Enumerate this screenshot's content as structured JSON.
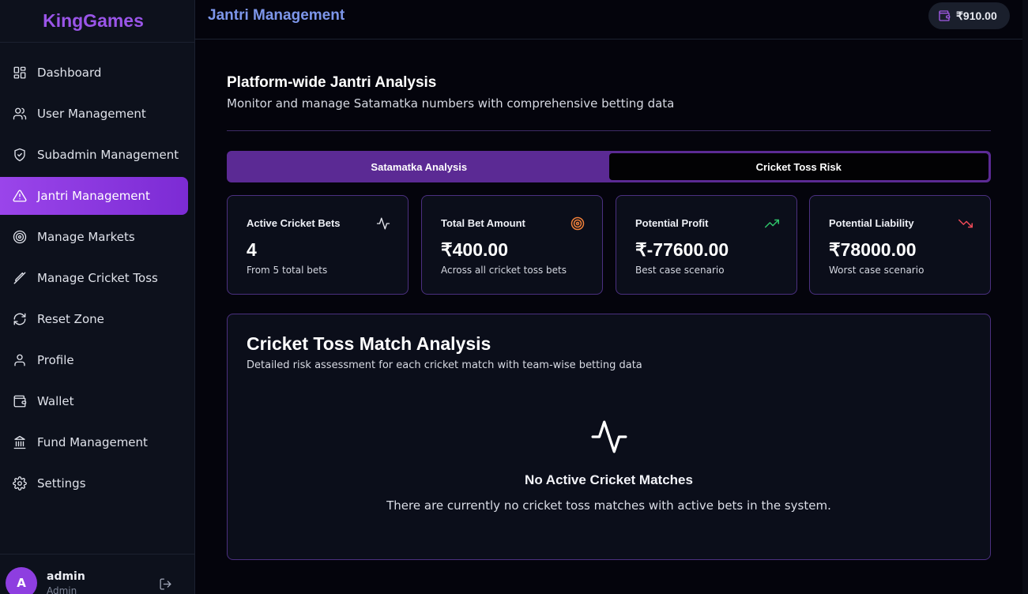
{
  "brand": "KingGames",
  "header": {
    "title": "Jantri Management",
    "wallet_balance": "₹910.00"
  },
  "sidebar": {
    "items": [
      {
        "label": "Dashboard",
        "icon": "dashboard-icon"
      },
      {
        "label": "User Management",
        "icon": "users-icon"
      },
      {
        "label": "Subadmin Management",
        "icon": "shield-icon"
      },
      {
        "label": "Jantri Management",
        "icon": "warning-icon",
        "active": true
      },
      {
        "label": "Manage Markets",
        "icon": "target-icon"
      },
      {
        "label": "Manage Cricket Toss",
        "icon": "cricket-bat-icon"
      },
      {
        "label": "Reset Zone",
        "icon": "refresh-icon"
      },
      {
        "label": "Profile",
        "icon": "user-icon"
      },
      {
        "label": "Wallet",
        "icon": "wallet-icon"
      },
      {
        "label": "Fund Management",
        "icon": "bank-icon"
      },
      {
        "label": "Settings",
        "icon": "gear-icon"
      }
    ],
    "user": {
      "initial": "A",
      "name": "admin",
      "role": "Admin"
    }
  },
  "page": {
    "title": "Platform-wide Jantri Analysis",
    "subtitle": "Monitor and manage Satamatka numbers with comprehensive betting data"
  },
  "tabs": [
    {
      "label": "Satamatka Analysis"
    },
    {
      "label": "Cricket Toss Risk",
      "selected": true
    }
  ],
  "stats": [
    {
      "label": "Active Cricket Bets",
      "value": "4",
      "note": "From 5 total bets",
      "icon": "activity-icon",
      "color": "#e6e7ee"
    },
    {
      "label": "Total Bet Amount",
      "value": "₹400.00",
      "note": "Across all cricket toss bets",
      "icon": "target-icon",
      "color": "#f0803a"
    },
    {
      "label": "Potential Profit",
      "value": "₹-77600.00",
      "note": "Best case scenario",
      "icon": "trending-up-icon",
      "color": "#2fc46a"
    },
    {
      "label": "Potential Liability",
      "value": "₹78000.00",
      "note": "Worst case scenario",
      "icon": "trending-down-icon",
      "color": "#ee4a57"
    }
  ],
  "panel": {
    "title": "Cricket Toss Match Analysis",
    "subtitle": "Detailed risk assessment for each cricket match with team-wise betting data",
    "empty_title": "No Active Cricket Matches",
    "empty_text": "There are currently no cricket toss matches with active bets in the system."
  }
}
